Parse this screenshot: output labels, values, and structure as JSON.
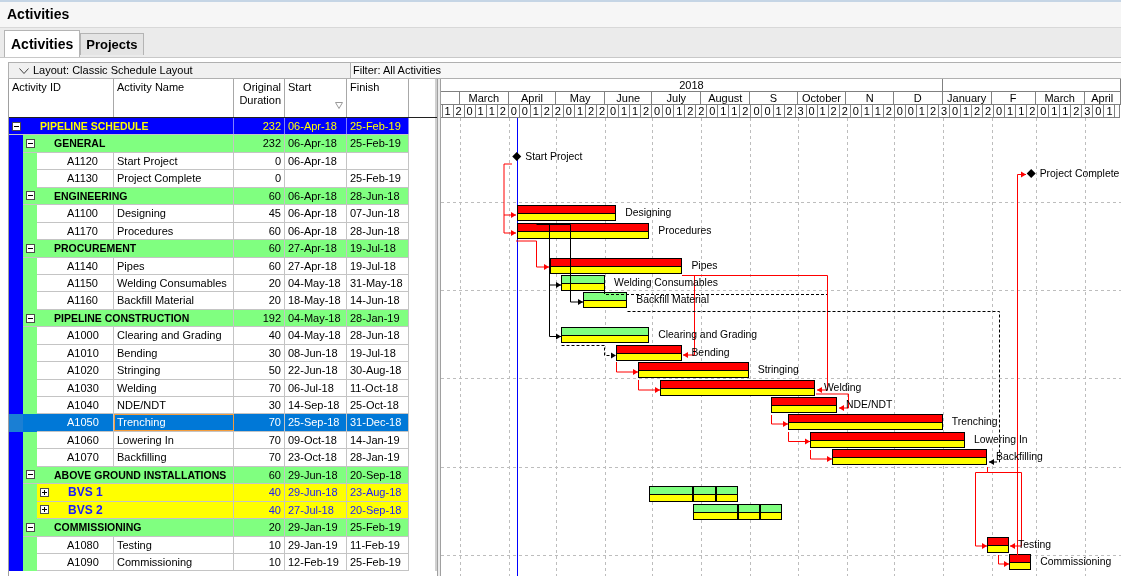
{
  "window": {
    "title": "Activities"
  },
  "tabs": [
    {
      "label": "Activities",
      "selected": true
    },
    {
      "label": "Projects",
      "selected": false
    }
  ],
  "layout_bar": {
    "layout": "Layout: Classic Schedule Layout",
    "filter": "Filter: All Activities"
  },
  "columns": [
    {
      "label": "Activity ID",
      "sorted": false
    },
    {
      "label": "Activity Name",
      "sorted": false
    },
    {
      "label": "Original Duration",
      "sorted": false
    },
    {
      "label": "Start",
      "sorted": true
    },
    {
      "label": "Finish",
      "sorted": false
    }
  ],
  "timescale": {
    "years": [
      "2018"
    ],
    "months": [
      "March",
      "April",
      "May",
      "June",
      "July",
      "August",
      "S",
      "October",
      "N",
      "D",
      "January",
      "F",
      "March",
      "April"
    ],
    "weeks": [
      "1",
      "2",
      "0",
      "1",
      "1",
      "2",
      "0",
      "0",
      "1",
      "2",
      "2",
      "0",
      "1",
      "2",
      "2",
      "0",
      "1",
      "1",
      "2",
      "0",
      "0",
      "1",
      "2",
      "2",
      "0",
      "1",
      "1",
      "2",
      "0",
      "0",
      "1",
      "2",
      "3",
      "0",
      "1",
      "2",
      "2",
      "0",
      "1",
      "1",
      "2",
      "0",
      "0",
      "1",
      "2",
      "3",
      "0",
      "1",
      "2",
      "2",
      "0",
      "1",
      "1",
      "2",
      "0",
      "1",
      "1",
      "2",
      "3",
      "0",
      "1"
    ]
  },
  "schedule": {
    "kind": "wbs",
    "name": "PIPELINE SCHEDULE",
    "duration": "232",
    "start": "06-Apr-18",
    "finish": "25-Feb-19",
    "expanded": true,
    "selected": false,
    "children": [
      {
        "kind": "wbs",
        "name": "GENERAL",
        "duration": "232",
        "start": "06-Apr-18",
        "finish": "25-Feb-19",
        "expanded": true,
        "selected": false,
        "children": [
          {
            "kind": "milestone",
            "id": "A1120",
            "name": "Start Project",
            "duration": "0",
            "start": "06-Apr-18",
            "selected": false,
            "bar_label": "Start Project"
          },
          {
            "kind": "milestone",
            "id": "A1130",
            "name": "Project Complete",
            "duration": "0",
            "finish": "25-Feb-19",
            "selected": false,
            "bar_label": "Project Complete"
          }
        ]
      },
      {
        "kind": "wbs",
        "name": "ENGINEERING",
        "duration": "60",
        "start": "06-Apr-18",
        "finish": "28-Jun-18",
        "expanded": true,
        "selected": false,
        "children": [
          {
            "kind": "task",
            "id": "A1100",
            "name": "Designing",
            "duration": "45",
            "start": "06-Apr-18",
            "finish": "07-Jun-18",
            "critical": true,
            "selected": false,
            "bar_label": "Designing"
          },
          {
            "kind": "task",
            "id": "A1170",
            "name": "Procedures",
            "duration": "60",
            "start": "06-Apr-18",
            "finish": "28-Jun-18",
            "critical": true,
            "selected": false,
            "bar_label": "Procedures"
          }
        ]
      },
      {
        "kind": "wbs",
        "name": "PROCUREMENT",
        "duration": "60",
        "start": "27-Apr-18",
        "finish": "19-Jul-18",
        "expanded": true,
        "selected": false,
        "children": [
          {
            "kind": "task",
            "id": "A1140",
            "name": "Pipes",
            "duration": "60",
            "start": "27-Apr-18",
            "finish": "19-Jul-18",
            "critical": true,
            "selected": false,
            "bar_label": "Pipes"
          },
          {
            "kind": "task",
            "id": "A1150",
            "name": "Welding Consumables",
            "duration": "20",
            "start": "04-May-18",
            "finish": "31-May-18",
            "critical": false,
            "selected": false,
            "bar_label": "Welding Consumables"
          },
          {
            "kind": "task",
            "id": "A1160",
            "name": "Backfill Material",
            "duration": "20",
            "start": "18-May-18",
            "finish": "14-Jun-18",
            "critical": false,
            "selected": false,
            "bar_label": "Backfill Material"
          }
        ]
      },
      {
        "kind": "wbs",
        "name": "PIPELINE CONSTRUCTION",
        "duration": "192",
        "start": "04-May-18",
        "finish": "28-Jan-19",
        "expanded": true,
        "selected": false,
        "children": [
          {
            "kind": "task",
            "id": "A1000",
            "name": "Clearing and Grading",
            "duration": "40",
            "start": "04-May-18",
            "finish": "28-Jun-18",
            "critical": false,
            "selected": false,
            "bar_label": "Clearing and Grading"
          },
          {
            "kind": "task",
            "id": "A1010",
            "name": "Bending",
            "duration": "30",
            "start": "08-Jun-18",
            "finish": "19-Jul-18",
            "critical": true,
            "selected": false,
            "bar_label": "Bending"
          },
          {
            "kind": "task",
            "id": "A1020",
            "name": "Stringing",
            "duration": "50",
            "start": "22-Jun-18",
            "finish": "30-Aug-18",
            "critical": true,
            "selected": false,
            "bar_label": "Stringing"
          },
          {
            "kind": "task",
            "id": "A1030",
            "name": "Welding",
            "duration": "70",
            "start": "06-Jul-18",
            "finish": "11-Oct-18",
            "critical": true,
            "selected": false,
            "bar_label": "Welding"
          },
          {
            "kind": "task",
            "id": "A1040",
            "name": "NDE/NDT",
            "duration": "30",
            "start": "14-Sep-18",
            "finish": "25-Oct-18",
            "critical": true,
            "selected": false,
            "bar_label": "NDE/NDT"
          },
          {
            "kind": "task",
            "id": "A1050",
            "name": "Trenching",
            "duration": "70",
            "start": "25-Sep-18",
            "finish": "31-Dec-18",
            "critical": true,
            "selected": true,
            "bar_label": "Trenching"
          },
          {
            "kind": "task",
            "id": "A1060",
            "name": "Lowering In",
            "duration": "70",
            "start": "09-Oct-18",
            "finish": "14-Jan-19",
            "critical": true,
            "selected": false,
            "bar_label": "Lowering In"
          },
          {
            "kind": "task",
            "id": "A1070",
            "name": "Backfilling",
            "duration": "70",
            "start": "23-Oct-18",
            "finish": "28-Jan-19",
            "critical": true,
            "selected": false,
            "bar_label": "Backfilling"
          }
        ]
      },
      {
        "kind": "wbs",
        "name": "ABOVE GROUND INSTALLATIONS",
        "duration": "60",
        "start": "29-Jun-18",
        "finish": "20-Sep-18",
        "expanded": true,
        "selected": false,
        "children": [
          {
            "kind": "wbs",
            "name": "BVS 1",
            "duration": "40",
            "start": "29-Jun-18",
            "finish": "23-Aug-18",
            "expanded": false,
            "critical": false,
            "selected": false
          },
          {
            "kind": "wbs",
            "name": "BVS 2",
            "duration": "40",
            "start": "27-Jul-18",
            "finish": "20-Sep-18",
            "expanded": false,
            "critical": false,
            "selected": false
          }
        ]
      },
      {
        "kind": "wbs",
        "name": "COMMISSIONING",
        "duration": "20",
        "start": "29-Jan-19",
        "finish": "25-Feb-19",
        "expanded": true,
        "selected": false,
        "children": [
          {
            "kind": "task",
            "id": "A1080",
            "name": "Testing",
            "duration": "10",
            "start": "29-Jan-19",
            "finish": "11-Feb-19",
            "critical": true,
            "selected": false,
            "bar_label": "Testing"
          },
          {
            "kind": "task",
            "id": "A1090",
            "name": "Commissioning",
            "duration": "10",
            "start": "12-Feb-19",
            "finish": "25-Feb-19",
            "critical": true,
            "selected": false,
            "bar_label": "Commissioning"
          }
        ]
      }
    ]
  }
}
